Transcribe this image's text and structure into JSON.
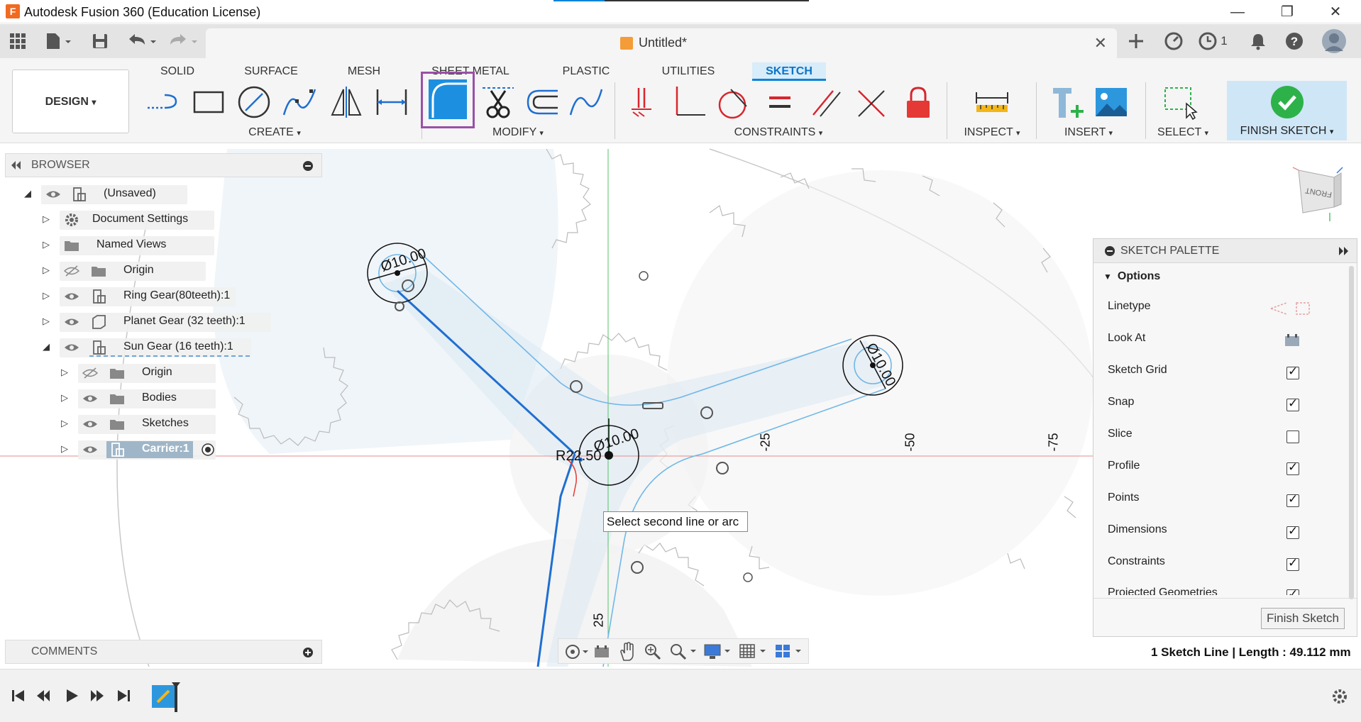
{
  "window": {
    "title": "Autodesk Fusion 360 (Education License)",
    "app_logo": "F",
    "controls": {
      "minimize": "—",
      "maximize": "❐",
      "close": "✕"
    }
  },
  "quick_access": {
    "icons": [
      "grid-icon",
      "file-icon",
      "save-icon",
      "undo-icon",
      "redo-icon"
    ],
    "right_icons": [
      "add-tab-icon",
      "extensions-icon",
      "job-status-icon",
      "notifications-icon",
      "help-icon",
      "user-avatar"
    ],
    "job_count": "1"
  },
  "document": {
    "name": "Untitled*",
    "close": "✕"
  },
  "ribbon": {
    "workspace": "DESIGN",
    "tabs": [
      {
        "label": "SOLID",
        "active": false
      },
      {
        "label": "SURFACE",
        "active": false
      },
      {
        "label": "MESH",
        "active": false
      },
      {
        "label": "SHEET METAL",
        "active": false
      },
      {
        "label": "PLASTIC",
        "active": false
      },
      {
        "label": "UTILITIES",
        "active": false
      },
      {
        "label": "SKETCH",
        "active": true
      }
    ],
    "groups": {
      "create": "CREATE",
      "modify": "MODIFY",
      "constraints": "CONSTRAINTS",
      "inspect": "INSPECT",
      "insert": "INSERT",
      "select": "SELECT",
      "finish": "FINISH SKETCH"
    },
    "dropdown_marker": "▾"
  },
  "browser": {
    "title": "BROWSER",
    "items": [
      {
        "label": "(Unsaved)"
      },
      {
        "label": "Document Settings"
      },
      {
        "label": "Named Views"
      },
      {
        "label": "Origin"
      },
      {
        "label": "Ring Gear(80teeth):1"
      },
      {
        "label": "Planet Gear (32 teeth):1"
      },
      {
        "label": "Sun Gear (16 teeth):1"
      },
      {
        "label": "Origin"
      },
      {
        "label": "Bodies"
      },
      {
        "label": "Sketches"
      },
      {
        "label": "Carrier:1"
      }
    ]
  },
  "canvas": {
    "dimensions": [
      "Ø10.00",
      "Ø10.00",
      "Ø10.00",
      "R22.50"
    ],
    "axis_labels": [
      "-25",
      "-50",
      "-75",
      "25"
    ],
    "tooltip": "Select second line or arc",
    "viewcube_face": "FRONT"
  },
  "sketch_palette": {
    "title": "SKETCH PALETTE",
    "section": "Options",
    "options": [
      {
        "label": "Linetype",
        "type": "icons"
      },
      {
        "label": "Look At",
        "type": "icon"
      },
      {
        "label": "Sketch Grid",
        "type": "checkbox",
        "checked": true
      },
      {
        "label": "Snap",
        "type": "checkbox",
        "checked": true
      },
      {
        "label": "Slice",
        "type": "checkbox",
        "checked": false
      },
      {
        "label": "Profile",
        "type": "checkbox",
        "checked": true
      },
      {
        "label": "Points",
        "type": "checkbox",
        "checked": true
      },
      {
        "label": "Dimensions",
        "type": "checkbox",
        "checked": true
      },
      {
        "label": "Constraints",
        "type": "checkbox",
        "checked": true
      },
      {
        "label": "Projected Geometries",
        "type": "checkbox",
        "checked": true
      }
    ],
    "finish_button": "Finish Sketch"
  },
  "comments": {
    "title": "COMMENTS"
  },
  "status": {
    "text": "1 Sketch Line | Length : 49.112 mm"
  },
  "colors": {
    "accent": "#0a84d8",
    "highlight_box": "#9b4fa8",
    "finish_green": "#2db24a",
    "sketch_blue": "#1f6fd1",
    "constraint_red": "#d7262e"
  }
}
